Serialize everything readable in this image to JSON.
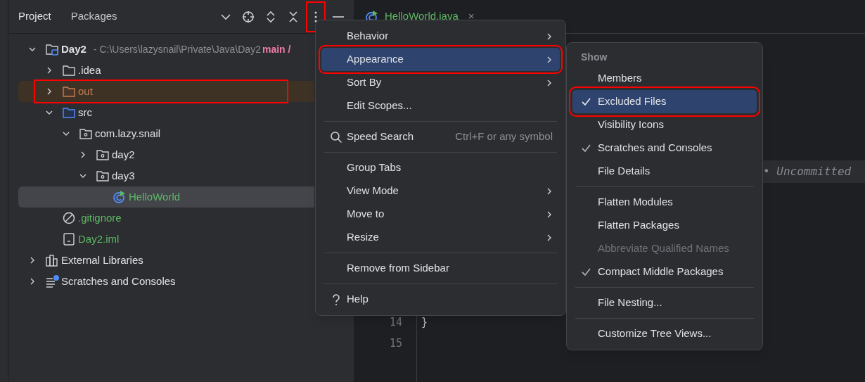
{
  "tool_window": {
    "tabs": [
      {
        "label": "Project",
        "selected": true
      },
      {
        "label": "Packages",
        "selected": false
      }
    ],
    "toolbar": [
      {
        "kind": "dropdown",
        "highlighted": false
      },
      {
        "kind": "locate",
        "highlighted": false
      },
      {
        "kind": "expand",
        "highlighted": false
      },
      {
        "kind": "collapse",
        "highlighted": false
      },
      {
        "kind": "more",
        "highlighted": true
      },
      {
        "kind": "hide",
        "highlighted": false
      }
    ],
    "tree": [
      {
        "label": "Day2",
        "kind": "module",
        "expanded": true,
        "path": "- C:\\Users\\lazysnail\\Private\\Java\\Day2",
        "branch": "main /",
        "color": "#dfe1e5",
        "selected": false,
        "highlighted": false,
        "children": [
          {
            "label": ".idea",
            "kind": "folder",
            "expanded": false,
            "color": "#dfe1e5",
            "selected": false,
            "highlighted": false
          },
          {
            "label": "out",
            "kind": "excluded",
            "expanded": false,
            "color": "#c77d55",
            "selected": false,
            "highlighted": true
          },
          {
            "label": "src",
            "kind": "source",
            "expanded": true,
            "color": "#dfe1e5",
            "selected": false,
            "highlighted": false,
            "children": [
              {
                "label": "com.lazy.snail",
                "kind": "package",
                "expanded": true,
                "color": "#dfe1e5",
                "selected": false,
                "highlighted": false,
                "children": [
                  {
                    "label": "day2",
                    "kind": "package",
                    "expanded": false,
                    "color": "#dfe1e5",
                    "selected": false,
                    "highlighted": false
                  },
                  {
                    "label": "day3",
                    "kind": "package",
                    "expanded": true,
                    "color": "#dfe1e5",
                    "selected": false,
                    "highlighted": false,
                    "children": [
                      {
                        "label": "HelloWorld",
                        "kind": "class",
                        "color": "#5fb865",
                        "selected": true,
                        "highlighted": false
                      }
                    ]
                  }
                ]
              }
            ]
          },
          {
            "label": ".gitignore",
            "kind": "ignore",
            "color": "#5fb865",
            "selected": false,
            "highlighted": false
          },
          {
            "label": "Day2.iml",
            "kind": "iml",
            "color": "#5fb865",
            "selected": false,
            "highlighted": false
          }
        ]
      },
      {
        "label": "External Libraries",
        "kind": "libraries",
        "expanded": false,
        "color": "#dfe1e5",
        "selected": false,
        "highlighted": false
      },
      {
        "label": "Scratches and Consoles",
        "kind": "scratches",
        "expanded": false,
        "color": "#dfe1e5",
        "selected": false,
        "highlighted": false
      }
    ]
  },
  "editor": {
    "tab": {
      "label": "HelloWorld.java",
      "close": "×"
    },
    "inlay": "• Uncommitted",
    "lines": [
      {
        "number": "14",
        "code": "}"
      },
      {
        "number": "15"
      }
    ]
  },
  "menu": {
    "items": [
      {
        "label": "Behavior",
        "kind": "submenu",
        "selected": false,
        "highlighted": false
      },
      {
        "label": "Appearance",
        "kind": "submenu",
        "selected": true,
        "highlighted": true
      },
      {
        "label": "Sort By",
        "kind": "submenu",
        "selected": false,
        "highlighted": false
      },
      {
        "label": "Edit Scopes...",
        "kind": "action",
        "selected": false,
        "highlighted": false
      },
      {
        "label": "Speed Search",
        "kind": "search",
        "shortcut": "Ctrl+F or any symbol",
        "separator_before": true,
        "selected": false,
        "highlighted": false
      },
      {
        "label": "Group Tabs",
        "kind": "action",
        "separator_before": true,
        "selected": false,
        "highlighted": false
      },
      {
        "label": "View Mode",
        "kind": "submenu",
        "selected": false,
        "highlighted": false
      },
      {
        "label": "Move to",
        "kind": "submenu",
        "selected": false,
        "highlighted": false
      },
      {
        "label": "Resize",
        "kind": "submenu",
        "selected": false,
        "highlighted": false
      },
      {
        "label": "Remove from Sidebar",
        "kind": "action",
        "separator_before": true,
        "selected": false,
        "highlighted": false
      },
      {
        "label": "Help",
        "kind": "help",
        "separator_before": true,
        "selected": false,
        "highlighted": false
      }
    ]
  },
  "submenu": {
    "header": "Show",
    "items": [
      {
        "label": "Members",
        "checked": false,
        "disabled": false,
        "selected": false,
        "highlighted": false
      },
      {
        "label": "Excluded Files",
        "checked": true,
        "disabled": false,
        "selected": true,
        "highlighted": true
      },
      {
        "label": "Visibility Icons",
        "checked": false,
        "disabled": false,
        "selected": false,
        "highlighted": false
      },
      {
        "label": "Scratches and Consoles",
        "checked": true,
        "disabled": false,
        "selected": false,
        "highlighted": false
      },
      {
        "label": "File Details",
        "checked": false,
        "disabled": false,
        "selected": false,
        "highlighted": false
      },
      {
        "label": "Flatten Modules",
        "checked": false,
        "disabled": false,
        "separator_before": true,
        "selected": false,
        "highlighted": false
      },
      {
        "label": "Flatten Packages",
        "checked": false,
        "disabled": false,
        "selected": false,
        "highlighted": false
      },
      {
        "label": "Abbreviate Qualified Names",
        "checked": false,
        "disabled": true,
        "selected": false,
        "highlighted": false
      },
      {
        "label": "Compact Middle Packages",
        "checked": true,
        "disabled": false,
        "selected": false,
        "highlighted": false
      },
      {
        "label": "File Nesting...",
        "checked": false,
        "disabled": false,
        "separator_before": true,
        "selected": false,
        "highlighted": false
      },
      {
        "label": "Customize Tree Views...",
        "checked": false,
        "disabled": false,
        "separator_before": true,
        "selected": false,
        "highlighted": false
      }
    ]
  }
}
